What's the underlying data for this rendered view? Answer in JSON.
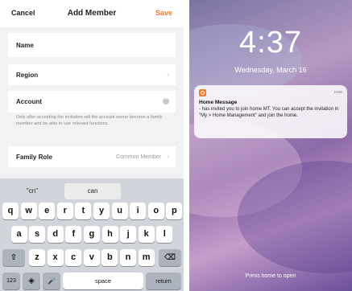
{
  "left": {
    "nav": {
      "cancel": "Cancel",
      "title": "Add Member",
      "save": "Save"
    },
    "form": {
      "name_label": "Name",
      "region_label": "Region",
      "account_label": "Account",
      "hint": "Only after accepting the invitation will the account owner become a family member and be able to use relevant functions.",
      "role_label": "Family Role",
      "role_value": "Common Member"
    },
    "keyboard": {
      "suggestions": [
        "\"cn\"",
        "can",
        ""
      ],
      "row1": [
        "q",
        "w",
        "e",
        "r",
        "t",
        "y",
        "u",
        "i",
        "o",
        "p"
      ],
      "row2": [
        "a",
        "s",
        "d",
        "f",
        "g",
        "h",
        "j",
        "k",
        "l"
      ],
      "row3": [
        "z",
        "x",
        "c",
        "v",
        "b",
        "n",
        "m"
      ],
      "shift_icon": "shift-icon",
      "backspace_icon": "backspace-icon",
      "numbers_label": "123",
      "globe_icon": "globe-icon",
      "mic_icon": "microphone-icon",
      "space_label": "space",
      "return_label": "return"
    },
    "accent_color": "#f07b2f"
  },
  "right": {
    "time": "4:37",
    "date": "Wednesday, March 16",
    "notification": {
      "app_icon": "home-app-icon",
      "time": "now",
      "title": "Home Message",
      "body": "- has invited you to join home MT. You can accept the invitation in \"My > Home Management\" and join the home."
    },
    "press_home": "Press home to open"
  }
}
